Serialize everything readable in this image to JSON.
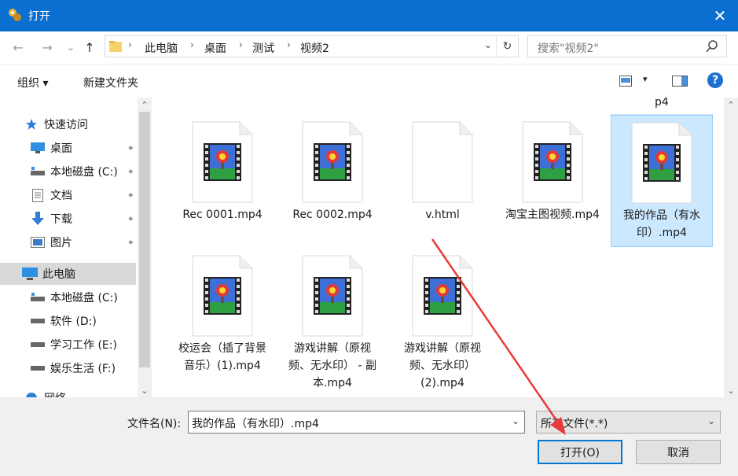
{
  "window": {
    "title": "打开",
    "close_glyph": "✕"
  },
  "nav": {
    "back_glyph": "←",
    "forward_glyph": "→",
    "recent_glyph": "⌄",
    "up_glyph": "↑",
    "breadcrumbs": [
      "此电脑",
      "桌面",
      "测试",
      "视频2"
    ],
    "separator": "›",
    "dropdown_glyph": "⌄",
    "refresh_glyph": "↻",
    "search_placeholder": "搜索\"视频2\""
  },
  "toolbar": {
    "organize_label": "组织 ▾",
    "new_folder_label": "新建文件夹",
    "view_dropdown_glyph": "▾",
    "help_glyph": "?"
  },
  "sidebar": {
    "items": [
      {
        "label": "快速访问",
        "icon": "star-icon",
        "pinned": false,
        "indent": 1
      },
      {
        "label": "桌面",
        "icon": "desktop-icon",
        "pinned": true,
        "indent": 2
      },
      {
        "label": "本地磁盘 (C:)",
        "icon": "drive-icon",
        "pinned": true,
        "indent": 2
      },
      {
        "label": "文档",
        "icon": "document-icon",
        "pinned": true,
        "indent": 2
      },
      {
        "label": "下载",
        "icon": "download-icon",
        "pinned": true,
        "indent": 2
      },
      {
        "label": "图片",
        "icon": "pictures-icon",
        "pinned": true,
        "indent": 2
      },
      {
        "label": "此电脑",
        "icon": "computer-icon",
        "pinned": false,
        "indent": 1,
        "selected": true
      },
      {
        "label": "本地磁盘 (C:)",
        "icon": "drive-icon",
        "pinned": false,
        "indent": 2
      },
      {
        "label": "软件 (D:)",
        "icon": "drive-icon",
        "pinned": false,
        "indent": 2
      },
      {
        "label": "学习工作 (E:)",
        "icon": "drive-icon",
        "pinned": false,
        "indent": 2
      },
      {
        "label": "娱乐生活 (F:)",
        "icon": "drive-icon",
        "pinned": false,
        "indent": 2
      },
      {
        "label": "网络",
        "icon": "network-icon",
        "pinned": false,
        "indent": 1
      }
    ],
    "pin_glyph": "📌",
    "scroll_up_glyph": "⌃",
    "scroll_down_glyph": "⌄"
  },
  "content": {
    "partial_label": "p4",
    "files": [
      {
        "name": "Rec 0001.mp4",
        "type": "video"
      },
      {
        "name": "Rec 0002.mp4",
        "type": "video"
      },
      {
        "name": "v.html",
        "type": "html"
      },
      {
        "name": "淘宝主图视频.mp4",
        "type": "video"
      },
      {
        "name": "我的作品（有水印）.mp4",
        "type": "video",
        "selected": true
      },
      {
        "name": "校运会（插了背景音乐）(1).mp4",
        "type": "video"
      },
      {
        "name": "游戏讲解（原视频、无水印） - 副本.mp4",
        "type": "video"
      },
      {
        "name": "游戏讲解（原视频、无水印）(2).mp4",
        "type": "video"
      }
    ],
    "scroll_up_glyph": "⌃",
    "scroll_down_glyph": "⌄"
  },
  "bottom": {
    "filename_label": "文件名(N):",
    "filename_value": "我的作品（有水印）.mp4",
    "filter_value": "所有文件(*.*)",
    "dropdown_glyph": "⌄",
    "open_label": "打开(O)",
    "cancel_label": "取消"
  },
  "colors": {
    "titlebar": "#0a6fd0",
    "selection": "#cce8ff",
    "annotation_arrow": "#e83a3a"
  }
}
